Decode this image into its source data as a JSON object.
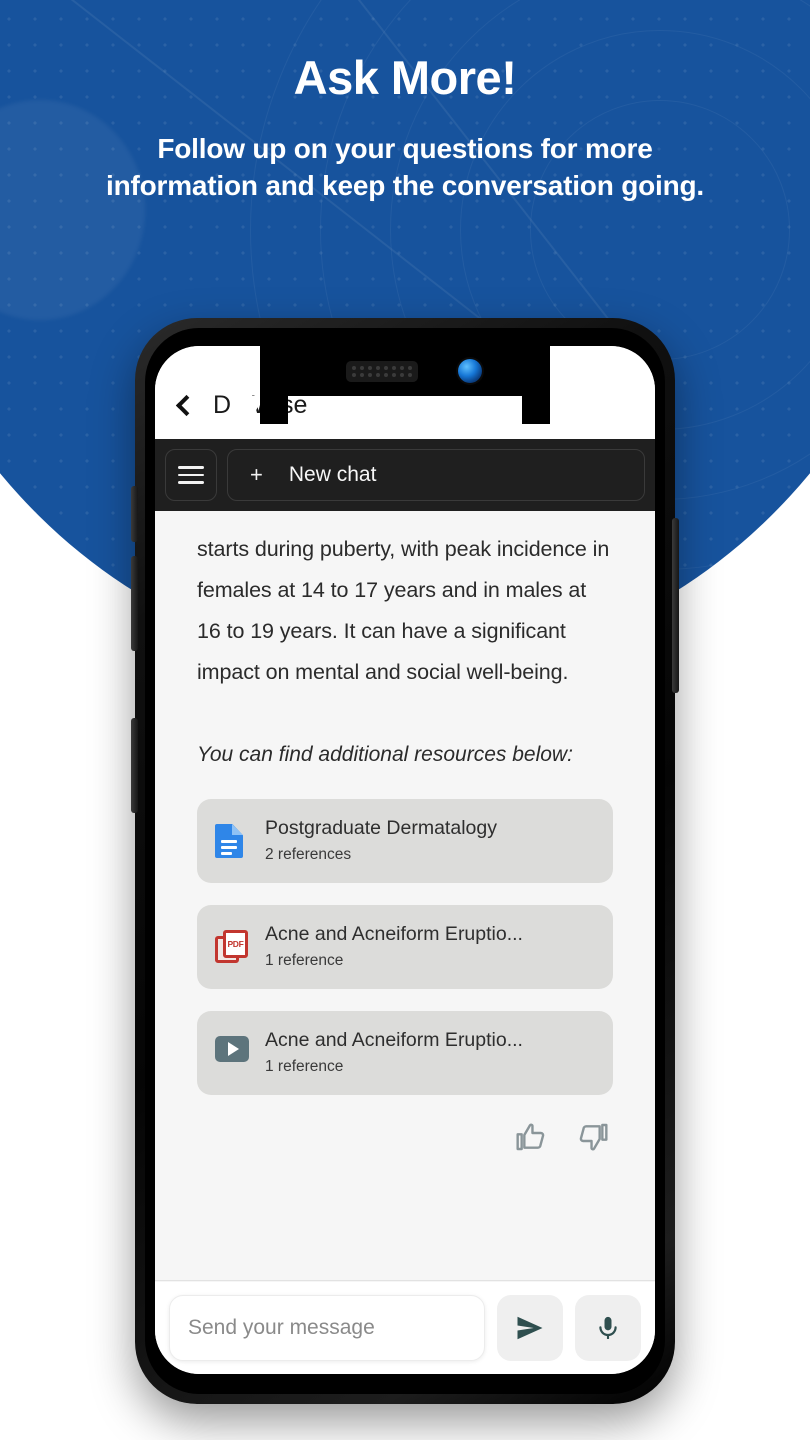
{
  "hero": {
    "title": "Ask More!",
    "subtitle": "Follow up on your questions for more information and keep the conversation going.",
    "background_color": "#17539d",
    "text_color": "#ffffff"
  },
  "phone": {
    "notch": {
      "speaker_icon": "speaker-grille-icon",
      "camera_icon": "front-camera-icon",
      "camera_color": "#1677d6"
    },
    "buttons": {
      "volume_up": "volume-up-button",
      "volume_down": "volume-down-button",
      "power": "power-button"
    }
  },
  "appbar": {
    "back_icon": "back-chevron-icon",
    "title": "Dr. Wise"
  },
  "newchat": {
    "menu_icon": "hamburger-menu-icon",
    "plus": "+",
    "label": "New chat",
    "background_color": "#1f1f1f"
  },
  "chat": {
    "message_paragraph": "starts during puberty, with peak incidence in females at 14 to 17 years and in males at 16 to 19 years. It can have a significant impact on mental and social well-being.",
    "resources_intro": "You can find additional resources below:",
    "cards": [
      {
        "icon": "google-doc-icon",
        "icon_color": "#2f86e8",
        "title": "Postgraduate Dermatalogy",
        "subtitle": "2 references"
      },
      {
        "icon": "pdf-file-icon",
        "icon_color": "#c2362f",
        "title": "Acne and Acneiform Eruptio...",
        "subtitle": "1 reference"
      },
      {
        "icon": "video-play-icon",
        "icon_color": "#5d747c",
        "title": "Acne and Acneiform Eruptio...",
        "subtitle": "1 reference"
      }
    ],
    "feedback": {
      "thumbs_up_icon": "thumbs-up-icon",
      "thumbs_down_icon": "thumbs-down-icon",
      "icon_color": "#8a9599"
    }
  },
  "composer": {
    "input_placeholder": "Send your message",
    "input_value": "",
    "send_icon": "send-icon",
    "mic_icon": "microphone-icon",
    "action_icon_color": "#2f4f4f"
  }
}
